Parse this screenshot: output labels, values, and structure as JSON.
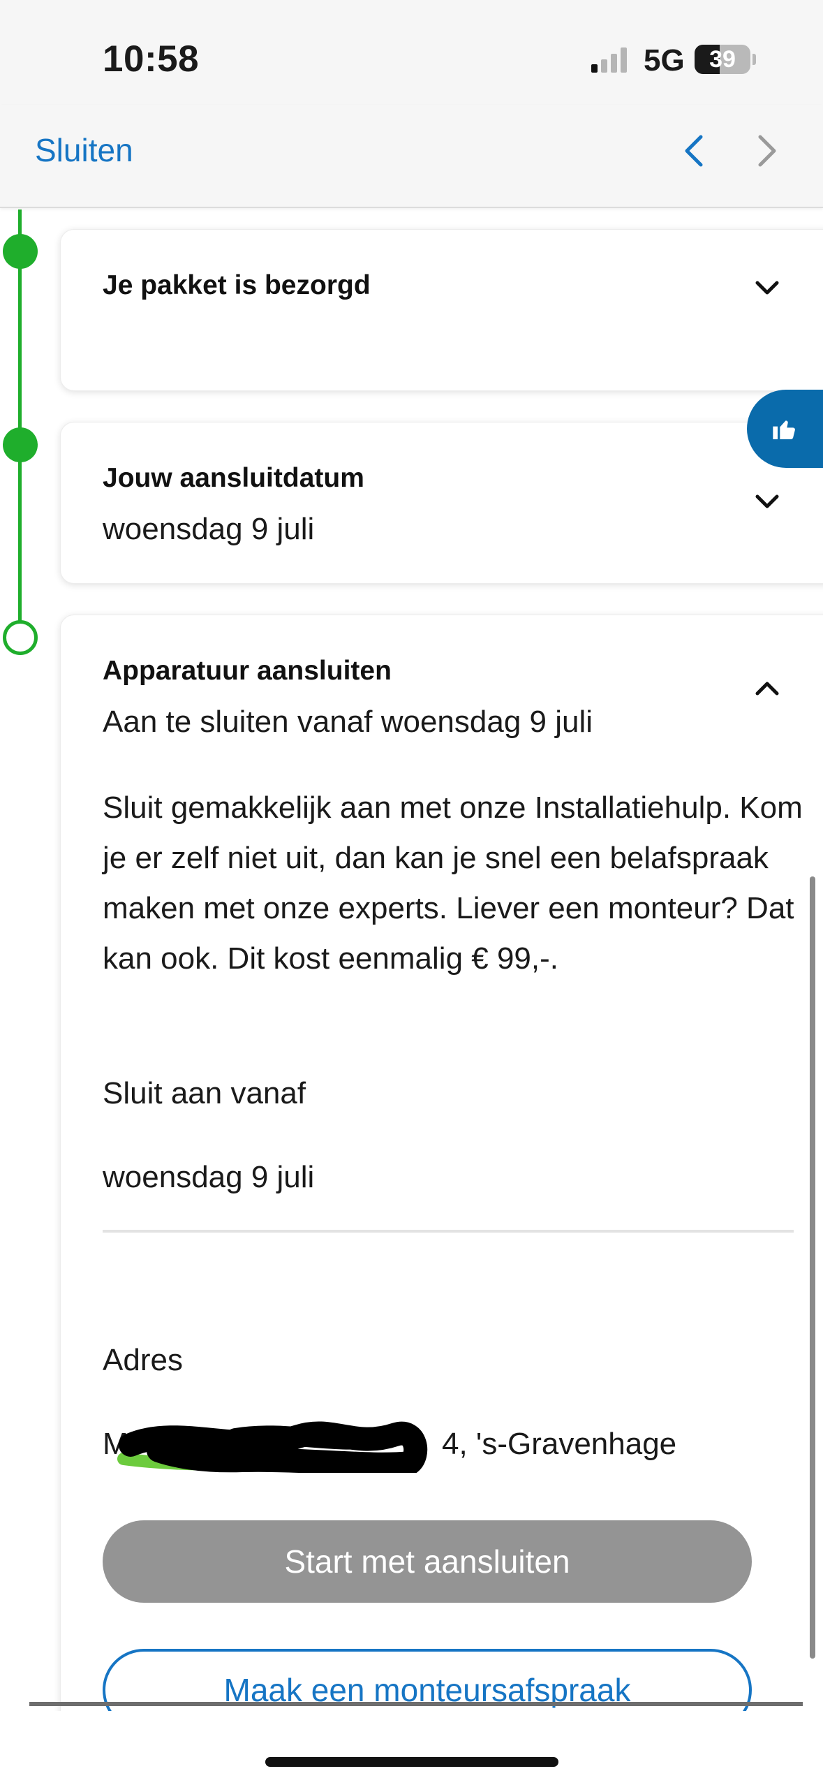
{
  "status_bar": {
    "time": "10:58",
    "network": "5G",
    "battery": "39"
  },
  "nav": {
    "close_label": "Sluiten",
    "prev_icon": "chevron-left-icon",
    "next_icon": "chevron-right-icon"
  },
  "timeline": {
    "steps": [
      {
        "title": "Je pakket is bezorgd",
        "subtitle": "",
        "state": "completed",
        "expanded": false
      },
      {
        "title": "Jouw aansluitdatum",
        "subtitle": "woensdag 9 juli",
        "state": "completed",
        "expanded": false
      },
      {
        "title": "Apparatuur aansluiten",
        "subtitle": "Aan te sluiten vanaf woensdag 9 juli",
        "state": "current",
        "expanded": true,
        "description": "Sluit gemakkelijk aan met onze Installatiehulp. Kom je er zelf niet uit, dan kan je snel een belafspraak maken met onze experts. Liever een monteur? Dat kan ook. Dit kost eenmalig € 99,-.",
        "connect_from_label": "Sluit aan vanaf",
        "connect_from_value": "woensdag 9 juli",
        "address_label": "Adres",
        "address_value_visible": "4, 's-Gravenhage",
        "address_prefix_visible": "M",
        "primary_button": "Start met aansluiten",
        "secondary_button": "Maak een monteursafspraak"
      }
    ]
  },
  "feedback_button": {
    "icon": "thumbs-up-icon"
  },
  "colors": {
    "accent_blue": "#1675c4",
    "timeline_green": "#1fae2c",
    "feedback_blue": "#0a6bab",
    "disabled_button": "#949494"
  }
}
